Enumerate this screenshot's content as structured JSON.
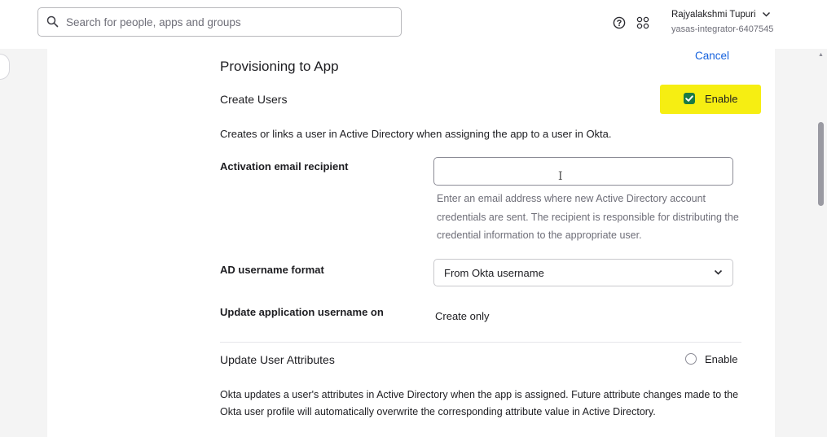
{
  "header": {
    "search_placeholder": "Search for people, apps and groups",
    "user_name": "Rajyalakshmi Tupuri",
    "org": "yasas-integrator-6407545"
  },
  "page": {
    "title": "Provisioning to App",
    "cancel_label": "Cancel"
  },
  "create_users": {
    "heading": "Create Users",
    "enabled": true,
    "enable_label": "Enable",
    "description": "Creates or links a user in Active Directory when assigning the app to a user in Okta.",
    "activation_label": "Activation email recipient",
    "activation_value": "",
    "activation_help": "Enter an email address where new Active Directory account credentials are sent. The recipient is responsible for distributing the credential information to the appropriate user.",
    "username_format_label": "AD username format",
    "username_format_value": "From Okta username",
    "update_username_label": "Update application username on",
    "update_username_value": "Create only"
  },
  "update_attributes": {
    "heading": "Update User Attributes",
    "enabled": false,
    "enable_label": "Enable",
    "description": "Okta updates a user's attributes in Active Directory when the app is assigned. Future attribute changes made to the Okta user profile will automatically overwrite the corresponding attribute value in Active Directory."
  },
  "icons": [
    "search-icon",
    "help-icon",
    "apps-grid-icon",
    "chevron-down-icon",
    "checkmark-icon",
    "text-cursor-icon"
  ],
  "colors": {
    "accent": "#1662dd",
    "checkbox_checked": "#1a7a45",
    "highlight": "#f6ee12",
    "help_text": "#6e6e78"
  }
}
